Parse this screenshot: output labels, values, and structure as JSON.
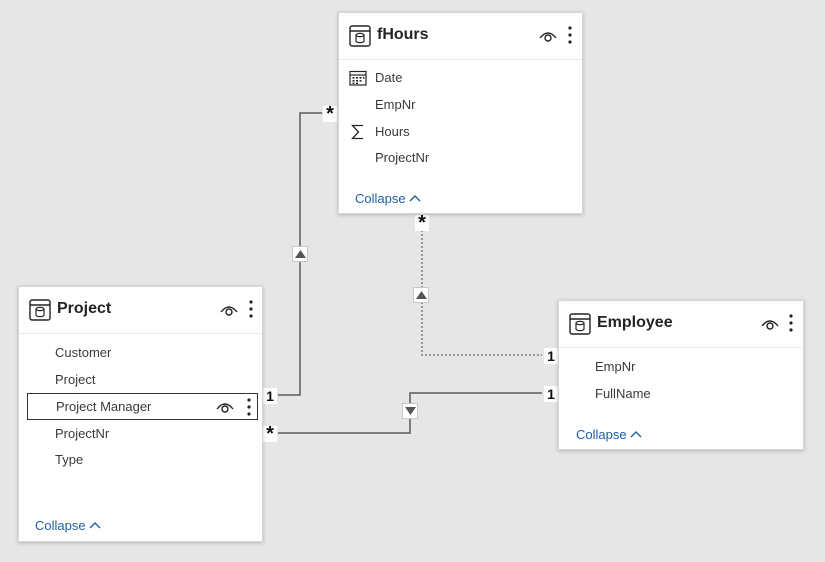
{
  "tables": {
    "fhours": {
      "title": "fHours",
      "fields": [
        {
          "label": "Date",
          "icon": "calendar-icon"
        },
        {
          "label": "EmpNr",
          "icon": ""
        },
        {
          "label": "Hours",
          "icon": "sigma-icon"
        },
        {
          "label": "ProjectNr",
          "icon": ""
        }
      ],
      "collapse_label": "Collapse"
    },
    "project": {
      "title": "Project",
      "fields": [
        {
          "label": "Customer"
        },
        {
          "label": "Project"
        },
        {
          "label": "Project Manager"
        },
        {
          "label": "ProjectNr"
        },
        {
          "label": "Type"
        }
      ],
      "collapse_label": "Collapse"
    },
    "employee": {
      "title": "Employee",
      "fields": [
        {
          "label": "EmpNr"
        },
        {
          "label": "FullName"
        }
      ],
      "collapse_label": "Collapse"
    }
  },
  "relationships": {
    "fhours_project": {
      "many_marker": "*",
      "one_marker": "1"
    },
    "fhours_employee": {
      "many_marker": "*",
      "one_marker": "1",
      "inactive": true
    },
    "project_employee": {
      "many_marker": "*",
      "one_marker": "1"
    }
  },
  "colors": {
    "canvas": "#e6e6e4",
    "link": "#1e5faa",
    "line": "#5a5a5a"
  }
}
